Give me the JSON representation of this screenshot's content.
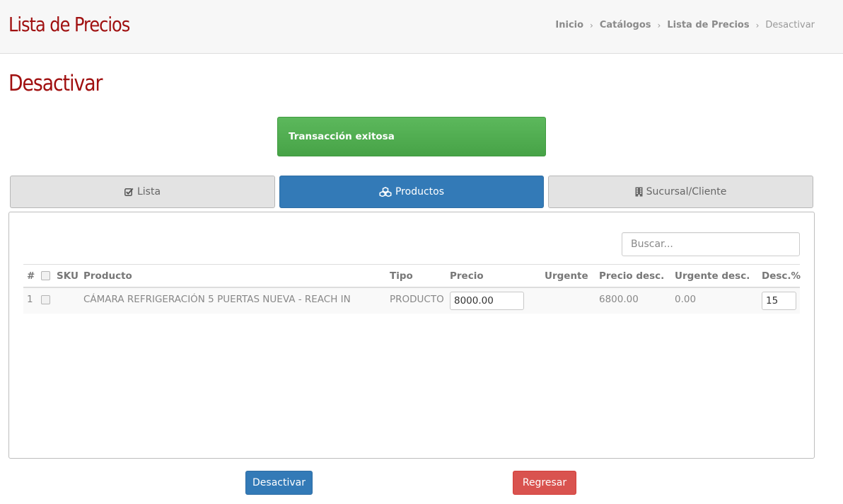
{
  "header": {
    "app_title": "Lista de Precios",
    "breadcrumb": {
      "items": [
        "Inicio",
        "Catálogos",
        "Lista de Precios"
      ],
      "separator": "›",
      "current": "Desactivar"
    }
  },
  "page_title": "Desactivar",
  "alert": {
    "message": "Transacción exitosa",
    "color": "#5cb85c"
  },
  "tabs": [
    {
      "label": "Lista",
      "icon": "check-square-icon",
      "active": false
    },
    {
      "label": "Productos",
      "icon": "cubes-icon",
      "active": true
    },
    {
      "label": "Sucursal/Cliente",
      "icon": "building-icon",
      "active": false
    }
  ],
  "search": {
    "placeholder": "Buscar...",
    "value": ""
  },
  "table": {
    "columns": [
      "#",
      "SKU",
      "Producto",
      "Tipo",
      "Precio",
      "Urgente",
      "Precio desc.",
      "Urgente desc.",
      "Desc.%"
    ],
    "rows": [
      {
        "num": "1",
        "sku": "",
        "producto": "CÁMARA REFRIGERACIÓN 5 PUERTAS NUEVA - REACH IN",
        "tipo": "PRODUCTO",
        "precio": "8000.00",
        "urgente": "",
        "precio_desc": "6800.00",
        "urgente_desc": "0.00",
        "desc_pct": "15"
      }
    ]
  },
  "buttons": {
    "deactivate": {
      "label": "Desactivar",
      "color": "#337ab7"
    },
    "back": {
      "label": "Regresar",
      "color": "#d9534f"
    }
  }
}
